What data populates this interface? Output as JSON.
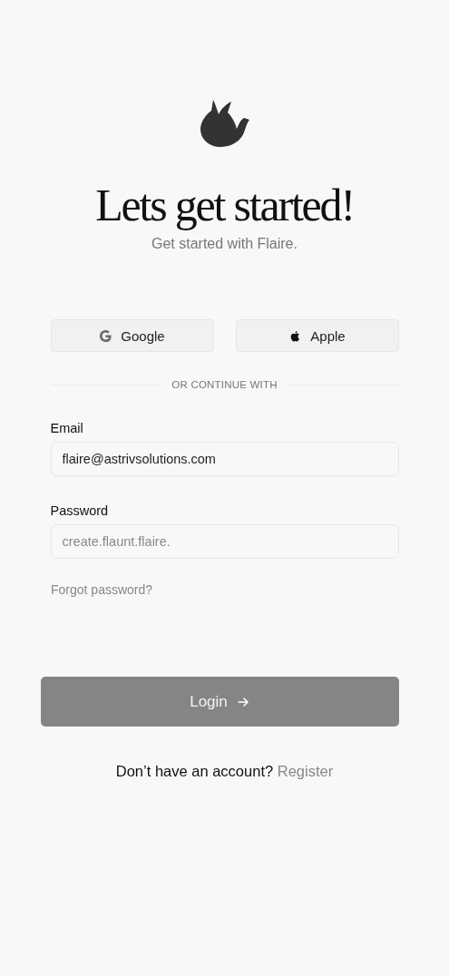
{
  "header": {
    "title": "Lets get started!",
    "subtitle": "Get started with Flaire."
  },
  "social_buttons": [
    {
      "kind": "google",
      "label": "Google"
    },
    {
      "kind": "apple",
      "label": "Apple"
    }
  ],
  "divider": "OR CONTINUE WITH",
  "fields": [
    {
      "label": "Email",
      "value": "flaire@astrivsolutions.com"
    },
    {
      "label": "Password",
      "placeholder": "create.flaunt.flaire."
    }
  ],
  "forgot_link": "Forgot password?",
  "login_button": {
    "label": "Login",
    "disabled": true
  },
  "footer": {
    "text": "Don’t have an account?",
    "link": "Register"
  }
}
